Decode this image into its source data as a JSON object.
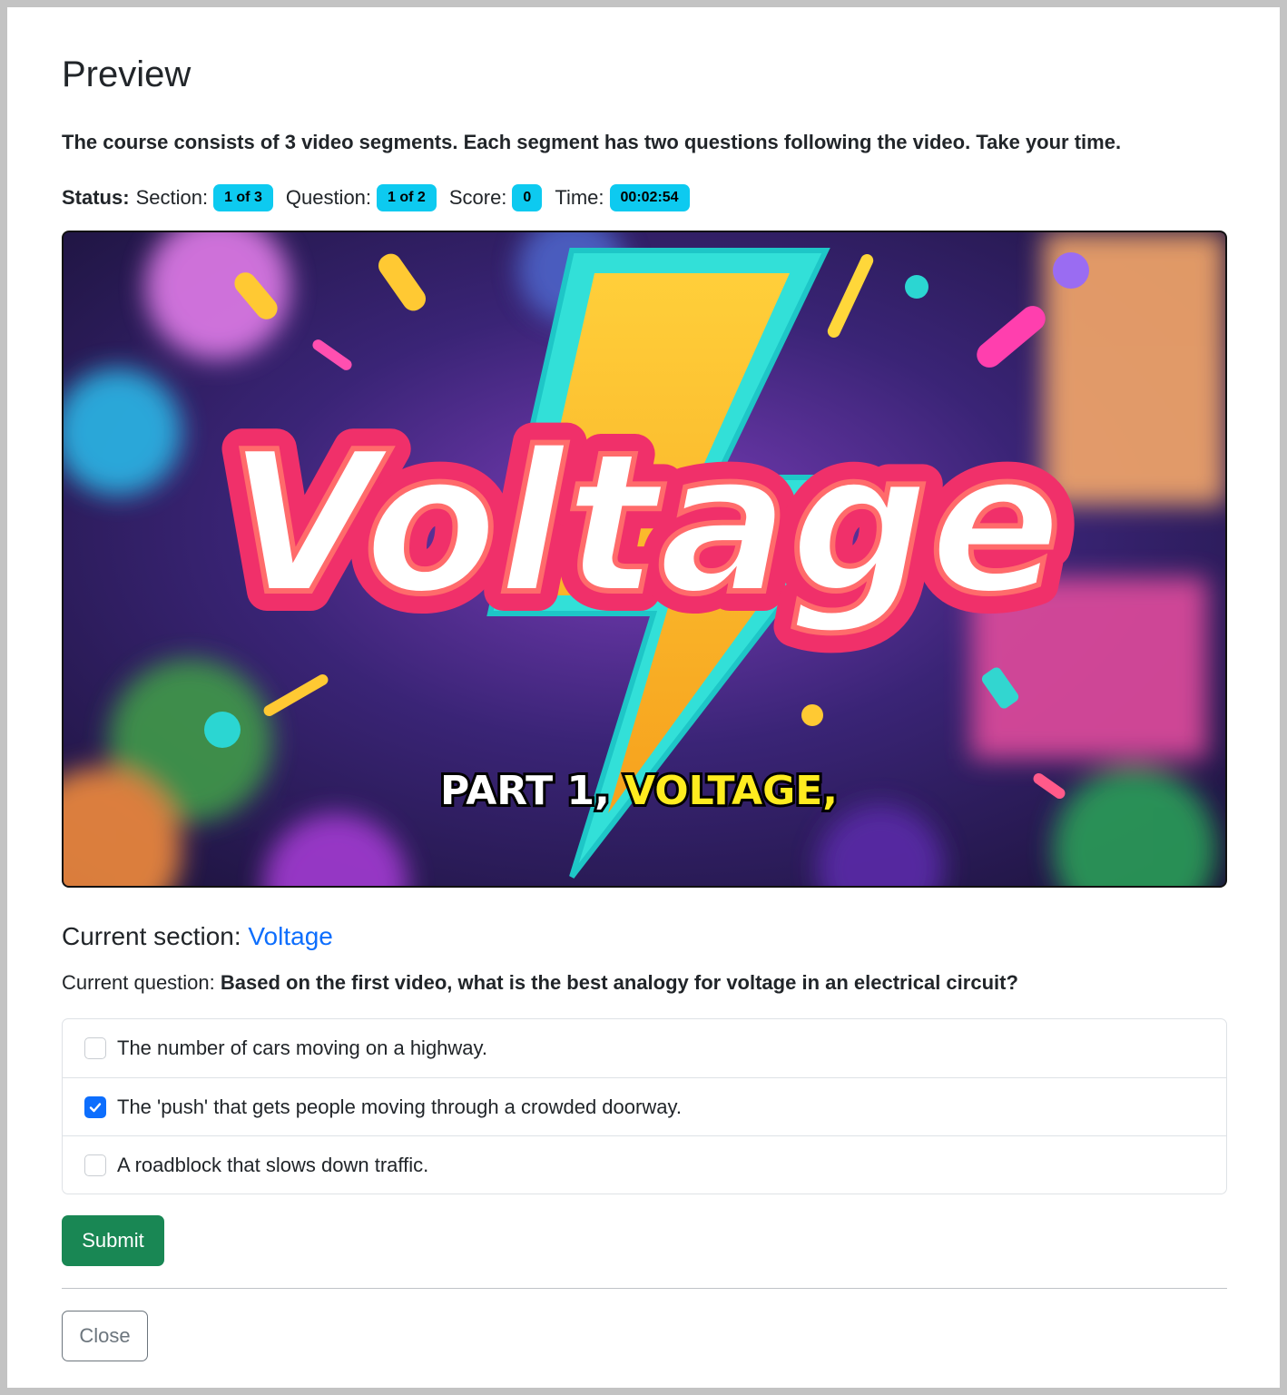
{
  "modal": {
    "title": "Preview",
    "intro": "The course consists of 3 video segments. Each segment has two questions following the video. Take your time."
  },
  "status": {
    "label": "Status:",
    "section_label": "Section:",
    "section_value": "1 of 3",
    "question_label": "Question:",
    "question_value": "1 of 2",
    "score_label": "Score:",
    "score_value": "0",
    "time_label": "Time:",
    "time_value": "00:02:54"
  },
  "video": {
    "title_text": "Voltage",
    "caption_white": "PART 1,",
    "caption_yellow": "VOLTAGE,"
  },
  "current_section": {
    "label": "Current section:",
    "value": "Voltage"
  },
  "current_question": {
    "label": "Current question:",
    "text": "Based on the first video, what is the best analogy for voltage in an electrical circuit?"
  },
  "options": [
    {
      "label": "The number of cars moving on a highway.",
      "checked": false
    },
    {
      "label": "The 'push' that gets people moving through a crowded doorway.",
      "checked": true
    },
    {
      "label": "A roadblock that slows down traffic.",
      "checked": false
    }
  ],
  "buttons": {
    "submit": "Submit",
    "close": "Close"
  },
  "colors": {
    "badge": "#0dcaf0",
    "link": "#0d6efd",
    "submit": "#198754",
    "checkbox_checked": "#0d6efd"
  }
}
